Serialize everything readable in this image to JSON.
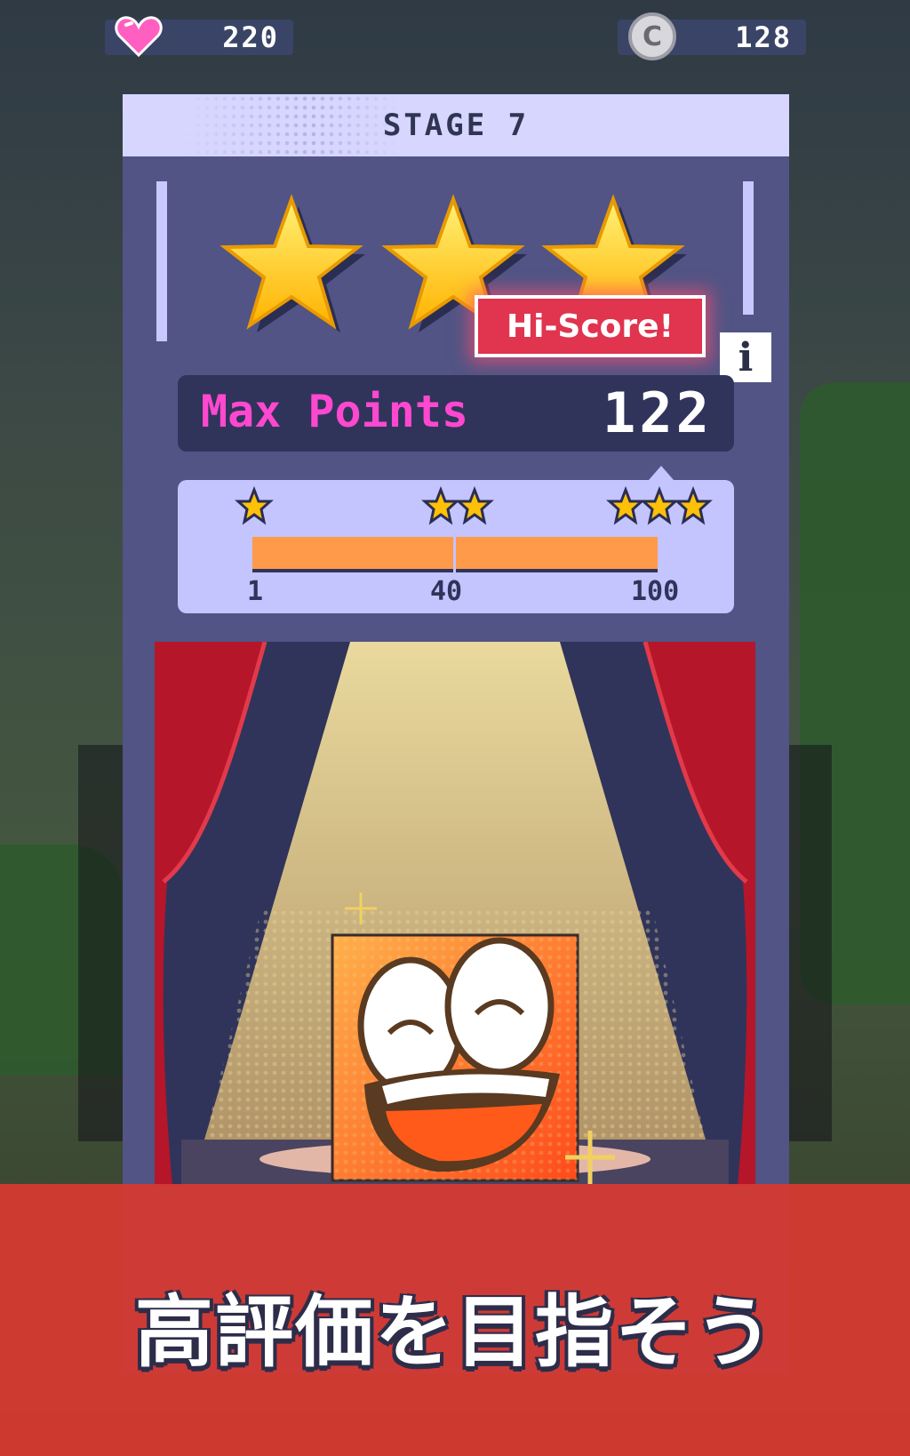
{
  "hud": {
    "lives_icon": "heart-icon",
    "lives": "220",
    "coins_icon": "coin-icon",
    "coin_symbol": "C",
    "coins": "128"
  },
  "panel": {
    "title": "STAGE 7",
    "stars_earned": 3,
    "stars_total": 3,
    "hi_score_badge": "Hi-Score!",
    "info_button": "i",
    "max_points_label": "Max Points",
    "max_points_value": "122",
    "thresholds": [
      {
        "stars": 1,
        "label": "1"
      },
      {
        "stars": 2,
        "label": "40"
      },
      {
        "stars": 3,
        "label": "100"
      }
    ],
    "progress_fraction": 1.0
  },
  "banner": {
    "text": "高評価を目指そう"
  },
  "colors": {
    "panel_bg": "#515485",
    "header_bg": "#d6d6ff",
    "accent_pink": "#ff48d0",
    "bar_fill": "#ff9a4a",
    "banner_red": "#d93a30",
    "curtain_red": "#b5162a"
  }
}
